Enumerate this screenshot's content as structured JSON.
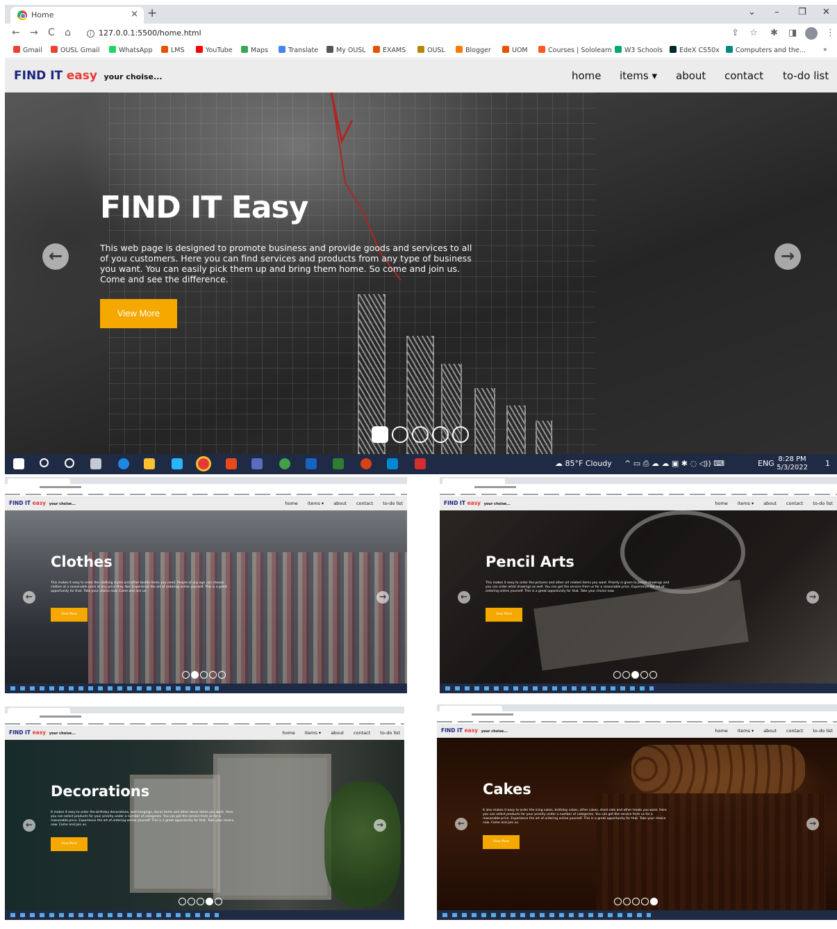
{
  "browser": {
    "tab_title": "Home",
    "tab_close": "×",
    "new_tab": "+",
    "url": "127.0.0.1:5500/home.html",
    "window_controls": [
      "⌄",
      "–",
      "❐",
      "✕"
    ],
    "nav_icons": [
      "←",
      "→",
      "C",
      "⌂"
    ],
    "toolbar_icons": [
      "⇪",
      "☆",
      "✱",
      "◨",
      "⋮"
    ],
    "bookmarks": [
      {
        "label": "Gmail",
        "color": "#ea4335"
      },
      {
        "label": "OUSL Gmail",
        "color": "#ea4335"
      },
      {
        "label": "WhatsApp",
        "color": "#25d366"
      },
      {
        "label": "LMS",
        "color": "#e65100"
      },
      {
        "label": "YouTube",
        "color": "#ff0000"
      },
      {
        "label": "Maps",
        "color": "#34a853"
      },
      {
        "label": "Translate",
        "color": "#4285f4"
      },
      {
        "label": "My OUSL",
        "color": "#555555"
      },
      {
        "label": "EXAMS",
        "color": "#e65100"
      },
      {
        "label": "OUSL",
        "color": "#b8860b"
      },
      {
        "label": "Blogger",
        "color": "#f57c00"
      },
      {
        "label": "UOM",
        "color": "#e65100"
      },
      {
        "label": "Courses | Sololearn",
        "color": "#ff5722"
      },
      {
        "label": "W3 Schools",
        "color": "#04aa6d"
      },
      {
        "label": "EdeX CS50x",
        "color": "#02262b"
      },
      {
        "label": "Computers and the...",
        "color": "#00897b"
      }
    ],
    "more_bookmarks": "»"
  },
  "site": {
    "brand_find": "FIND IT",
    "brand_easy": "easy",
    "brand_tag": "your choise...",
    "nav": [
      "home",
      "items ▾",
      "about",
      "contact",
      "to-do list"
    ]
  },
  "hero": {
    "title": "FIND IT Easy",
    "text": "This web page is designed to promote business and provide goods and services to all of you customers. Here you can find services and products from any type of business you want. You can easily pick them up and bring them home. So come and join us. Come and see the difference.",
    "button": "View More",
    "prev": "←",
    "next": "→",
    "active_slide": 1,
    "slide_count": 5
  },
  "taskbar": {
    "weather": "85°F Cloudy",
    "lang": "ENG",
    "time": "8:28 PM",
    "date": "5/3/2022",
    "notif": "1"
  },
  "thumbnails": [
    {
      "title": "Clothes",
      "text": "This makes it easy to order the clothing styles and other textile items you need. People of any age can choose clothes at a reasonable price at any price they like. Experience the art of ordering online yourself. This is a great opportunity for that. Take your choice now. Come and join us.",
      "button": "View More",
      "active_slide": 2
    },
    {
      "title": "Pencil Arts",
      "text": "This makes it easy to order the pictures and other art related items you want. Priority is given to pencil drawings and you can order what drawings as well. You can get the service from us for a reasonable price. Experience the art of ordering online yourself. This is a great opportunity for that. Take your choice now.",
      "button": "View More",
      "active_slide": 3
    },
    {
      "title": "Decorations",
      "text": "It makes it easy to order the birthday decorations, wall hangings, decor items and other decor items you want. Here you can select products for your priority under a number of categories. You can get the service from us for a reasonable price. Experience the art of ordering online yourself. This is a great opportunity for that. Take your choice now. Come and join us.",
      "button": "View More",
      "active_slide": 4
    },
    {
      "title": "Cakes",
      "text": "It also makes it easy to order the icing cakes, birthday cakes, other cakes, short eats and other treats you want. Here you can select products for your priority under a number of categories. You can get the service from us for a reasonable price. Experience the art of ordering online yourself. This is a great opportunity for that. Take your choice now. Come and join us.",
      "button": "View More",
      "active_slide": 5
    }
  ],
  "colors": {
    "accent": "#f5a800",
    "brand_blue": "#1a237e",
    "brand_red": "#e53935",
    "taskbar": "#1f2a44"
  }
}
